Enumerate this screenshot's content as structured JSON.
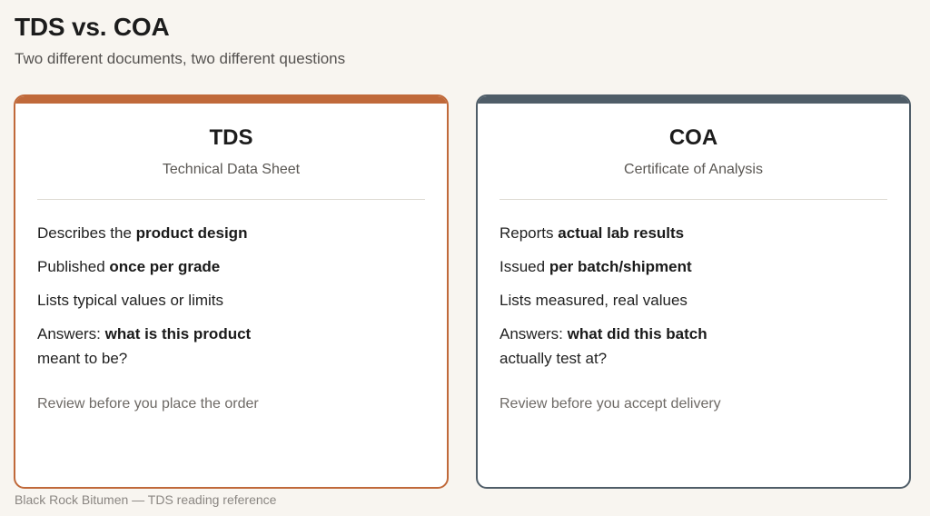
{
  "header": {
    "title": "TDS vs. COA",
    "subtitle": "Two different documents, two different questions"
  },
  "cards": [
    {
      "title": "TDS",
      "subtitle": "Technical Data Sheet",
      "accent": "#c0693a",
      "lines": [
        {
          "pre": "Describes the ",
          "bold": "product design",
          "post": ""
        },
        {
          "pre": "Published ",
          "bold": "once per grade",
          "post": ""
        },
        {
          "pre": "Lists typical values or limits",
          "bold": "",
          "post": ""
        },
        {
          "pre": "Answers: ",
          "bold": "what is this product",
          "post": " meant to be?"
        }
      ],
      "note": "Review before you place the order"
    },
    {
      "title": "COA",
      "subtitle": "Certificate of Analysis",
      "accent": "#4f5d68",
      "lines": [
        {
          "pre": "Reports ",
          "bold": "actual lab results",
          "post": ""
        },
        {
          "pre": "Issued ",
          "bold": "per batch/shipment",
          "post": ""
        },
        {
          "pre": "Lists measured, real values",
          "bold": "",
          "post": ""
        },
        {
          "pre": "Answers: ",
          "bold": "what did this batch",
          "post": " actually test at?"
        }
      ],
      "note": "Review before you accept delivery"
    }
  ],
  "footer": {
    "text": "Black Rock Bitumen — TDS reading reference"
  }
}
